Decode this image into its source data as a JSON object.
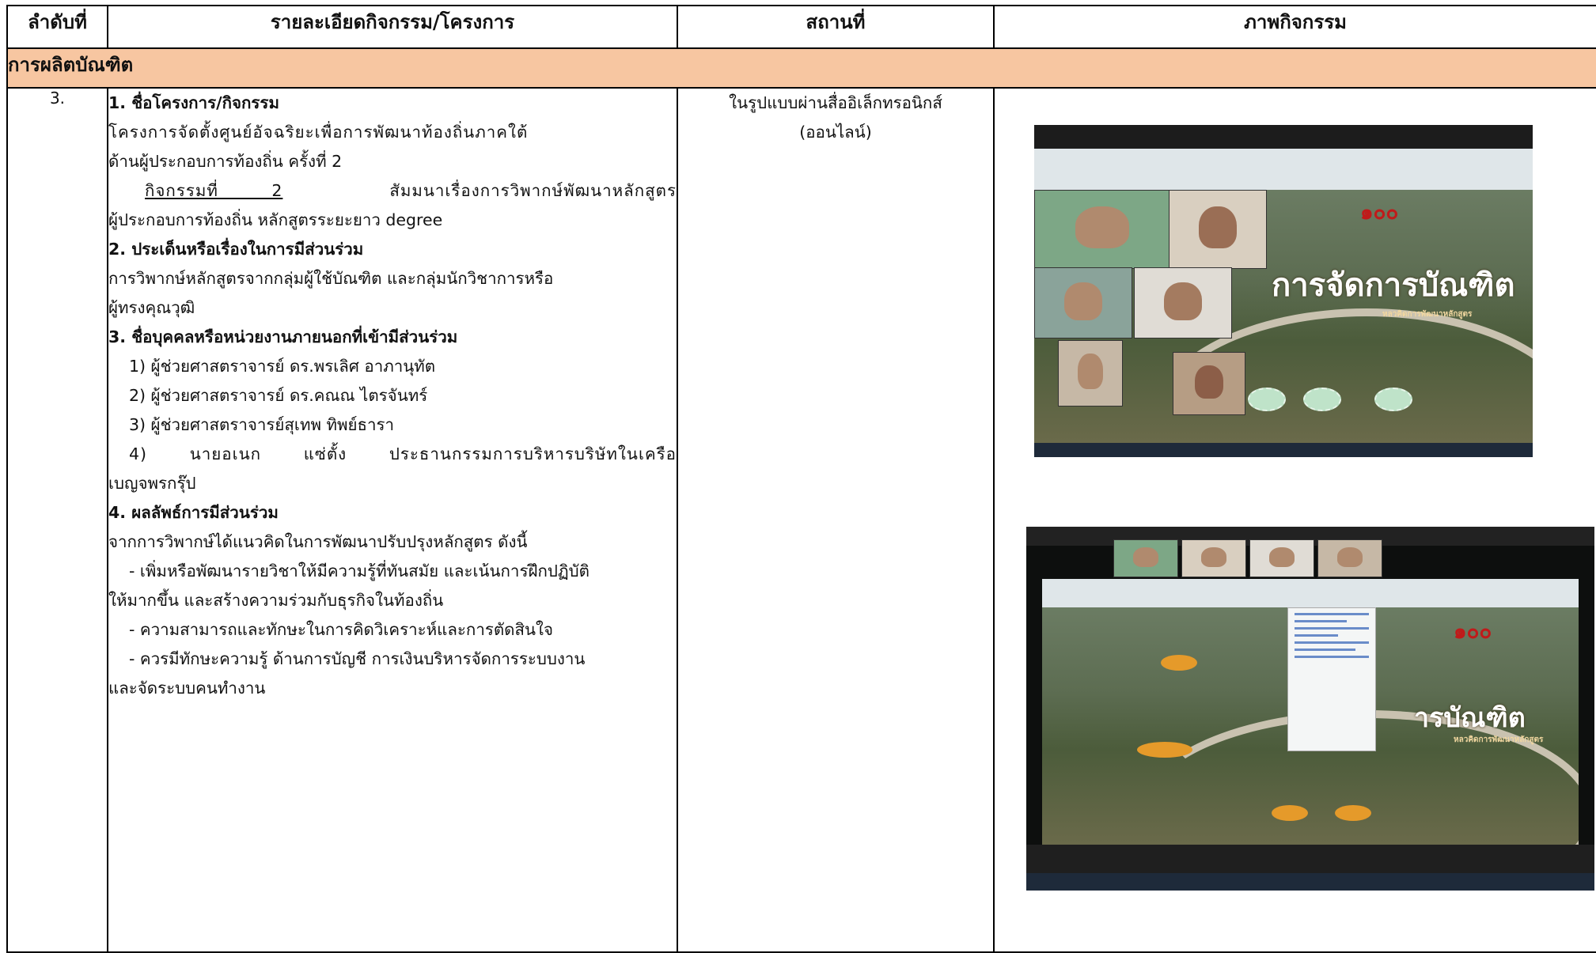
{
  "table": {
    "headers": [
      "ลำดับที่",
      "รายละเอียดกิจกรรม/โครงการ",
      "สถานที่",
      "ภาพกิจกรรม"
    ],
    "section_title": "การผลิตบัณฑิต",
    "row": {
      "number": "3.",
      "h1": "1. ชื่อโครงการ/กิจกรรม",
      "p1_line1": "โครงการจัดตั้งศูนย์อัจฉริยะเพื่อการพัฒนาท้องถิ่นภาคใต้",
      "p1_line2": "ด้านผู้ประกอบการท้องถิ่น ครั้งที่ 2",
      "activity_label": "กิจกรรมที่ 2",
      "activity_text": "สัมมนาเรื่องการวิพากษ์พัฒนาหลักสูตร",
      "activity_line2": "ผู้ประกอบการท้องถิ่น หลักสูตรระยะยาว degree",
      "h2": "2. ประเด็นหรือเรื่องในการมีส่วนร่วม",
      "p2_line1": "การวิพากษ์หลักสูตรจากกลุ่มผู้ใช้บัณฑิต และกลุ่มนักวิชาการหรือ",
      "p2_line2": "ผู้ทรงคุณวุฒิ",
      "h3": "3. ชื่อบุคคลหรือหน่วยงานภายนอกที่เข้ามีส่วนร่วม",
      "people": [
        "1) ผู้ช่วยศาสตราจารย์ ดร.พรเลิศ  อาภานุทัต",
        "2) ผู้ช่วยศาสตราจารย์ ดร.คณณ   ไตรจันทร์",
        "3) ผู้ช่วยศาสตราจารย์สุเทพ  ทิพย์ธารา",
        "4)   นายอเนก แซ่ตั้ง ประธานกรรมการบริหารบริษัทในเครือ"
      ],
      "people_line5": "เบญจพรกรุ๊ป",
      "h4": "4. ผลลัพธ์การมีส่วนร่วม",
      "p4_intro": "จากการวิพากษ์ได้แนวคิดในการพัฒนาปรับปรุงหลักสูตร ดังนี้",
      "results": [
        "- เพิ่มหรือพัฒนารายวิชาให้มีความรู้ที่ทันสมัย และเน้นการฝึกปฏิบัติ",
        "ให้มากขึ้น และสร้างความร่วมกับธุรกิจในท้องถิ่น",
        "- ความสามารถและทักษะในการคิดวิเคราะห์และการตัดสินใจ",
        "- ควรมีทักษะความรู้ ด้านการบัญชี การเงินบริหารจัดการระบบงาน",
        "และจัดระบบคนทำงาน"
      ],
      "location_line1": "ในรูปแบบผ่านสื่ออิเล็กทรอนิกส์",
      "location_line2": "(ออนไลน์)"
    }
  },
  "screenshots": {
    "shot1": {
      "slide_title": "การจัดการบัณฑิต",
      "slide_subtitle": "หลวคิดการพัฒนาหลักสูตร",
      "logo_text": "๑๐๐"
    },
    "shot2": {
      "slide_title": "ารบัณฑิต",
      "slide_subtitle": "หลวคิดการพัฒนาหลักสูตร",
      "logo_text": "๑๐๐"
    }
  },
  "colors": {
    "section_bg": "#f7c6a1",
    "border": "#000000"
  }
}
